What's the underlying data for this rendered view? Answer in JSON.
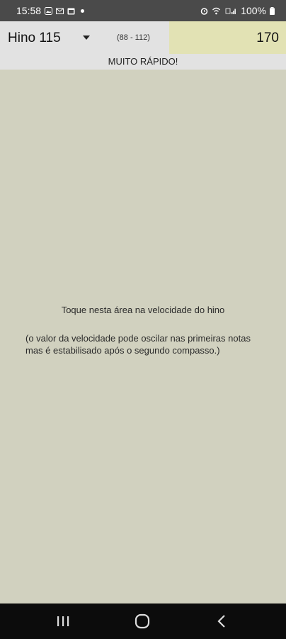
{
  "status": {
    "time": "15:58",
    "battery": "100%"
  },
  "header": {
    "hymn_label": "Hino 115",
    "range": "(88 - 112)",
    "bpm": "170"
  },
  "speed_status": "MUITO RÁPIDO!",
  "tap_area": {
    "instruction": "Toque nesta área na velocidade do hino",
    "note": "(o valor da velocidade pode oscilar nas primeiras notas mas é estabilisado após o segundo compasso.)"
  },
  "colors": {
    "background": "#d1d1bf",
    "header": "#e2e2e2",
    "bpm_highlight": "#e2e2b4"
  }
}
